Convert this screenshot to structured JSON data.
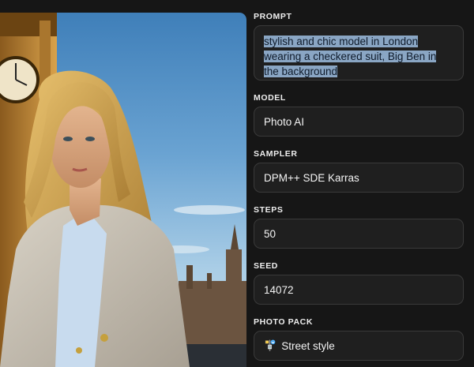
{
  "image": {
    "alt": "",
    "icon": "generated-photo"
  },
  "fields": {
    "prompt": {
      "label": "PROMPT",
      "value": "stylish and chic model in London wearing a checkered suit, Big Ben in the background"
    },
    "model": {
      "label": "MODEL",
      "value": "Photo AI"
    },
    "sampler": {
      "label": "SAMPLER",
      "value": "DPM++ SDE Karras"
    },
    "steps": {
      "label": "STEPS",
      "value": "50"
    },
    "seed": {
      "label": "SEED",
      "value": "14072"
    },
    "photo_pack": {
      "label": "PHOTO PACK",
      "icon": "🚏",
      "value": "Street style"
    }
  }
}
